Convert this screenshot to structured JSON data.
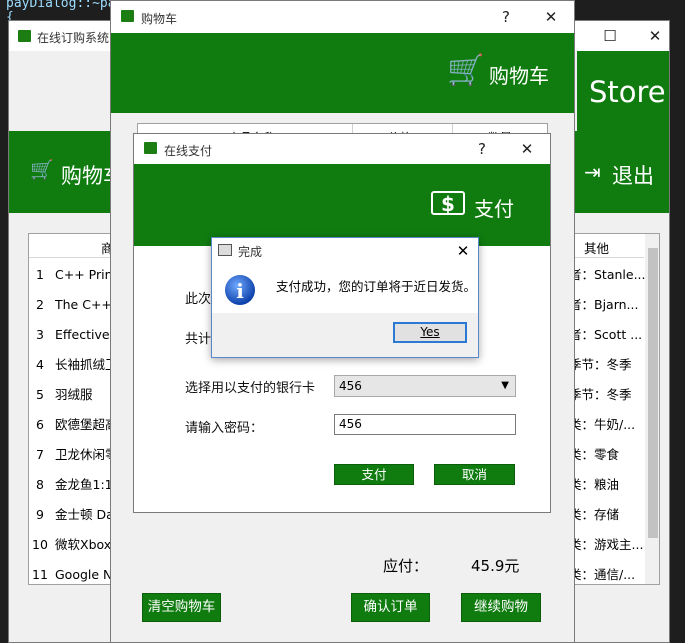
{
  "code_lines": [
    "payDialog::~payDialog()",
    "{"
  ],
  "main_window": {
    "title": "在线订购系统",
    "store_label": "Store",
    "cart_label": "购物车",
    "exit_label": "退出",
    "columns": [
      "商",
      "其他"
    ],
    "rows": [
      {
        "num": "1",
        "name": "C++ Prim",
        "other": "者：Stanle..."
      },
      {
        "num": "2",
        "name": "The C++ I",
        "other": "者：Bjarn..."
      },
      {
        "num": "3",
        "name": "Effective C",
        "other": "者：Scott ..."
      },
      {
        "num": "4",
        "name": "长袖抓绒卫",
        "other": "季节：冬季"
      },
      {
        "num": "5",
        "name": "羽绒服",
        "other": "季节：冬季"
      },
      {
        "num": "6",
        "name": "欧德堡超高",
        "other": "类：牛奶/..."
      },
      {
        "num": "7",
        "name": "卫龙休闲零",
        "other": "类：零食"
      },
      {
        "num": "8",
        "name": "金龙鱼1:1:",
        "other": "类：粮油"
      },
      {
        "num": "9",
        "name": "金士顿 Da",
        "other": "类：存储"
      },
      {
        "num": "10",
        "name": "微软Xbox",
        "other": "类：游戏主..."
      },
      {
        "num": "11",
        "name": "Google N",
        "other": "类：通信/..."
      }
    ]
  },
  "cart_window": {
    "title": "购物车",
    "banner": "购物车",
    "columns": [
      "商品名称",
      "价格",
      "数量"
    ],
    "total_label": "应付：",
    "total_value": "45.9元",
    "clear_button": "清空购物车",
    "confirm_button": "确认订单",
    "continue_button": "继续购物"
  },
  "pay_window": {
    "title": "在线支付",
    "banner": "支付",
    "label_this": "此次",
    "label_total": "共计",
    "label_card": "选择用以支付的银行卡",
    "card_value": "456",
    "label_password": "请输入密码：",
    "password_value": "456",
    "pay_button": "支付",
    "cancel_button": "取消"
  },
  "message_box": {
    "title": "完成",
    "message": "支付成功，您的订单将于近日发货。",
    "yes_button": "Yes"
  }
}
